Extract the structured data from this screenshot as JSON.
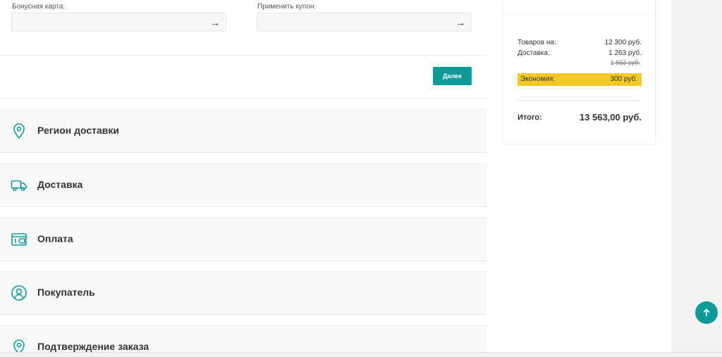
{
  "coupon": {
    "bonus_label": "Бонусная карта:",
    "bonus_value": "",
    "coupon_label": "Применить купон:",
    "coupon_value": "",
    "arrow": "→"
  },
  "next_button": "Далее",
  "sections": [
    {
      "title": "Регион доставки",
      "icon": "location-pin-icon"
    },
    {
      "title": "Доставка",
      "icon": "truck-icon"
    },
    {
      "title": "Оплата",
      "icon": "wallet-icon"
    },
    {
      "title": "Покупатель",
      "icon": "user-icon"
    },
    {
      "title": "Подтверждение заказа",
      "icon": "location-pin-icon"
    }
  ],
  "summary": {
    "goods_label": "Товаров на:",
    "goods_value": "12 300 руб.",
    "delivery_label": "Доставка:",
    "delivery_value": "1 263 руб.",
    "delivery_old": "1 563 руб.",
    "economy_label": "Экономия:",
    "economy_value": "300 руб.",
    "total_label": "Итого:",
    "total_value": "13 563,00 руб."
  },
  "colors": {
    "accent": "#0f9a9a",
    "economy": "#f5c82a"
  }
}
